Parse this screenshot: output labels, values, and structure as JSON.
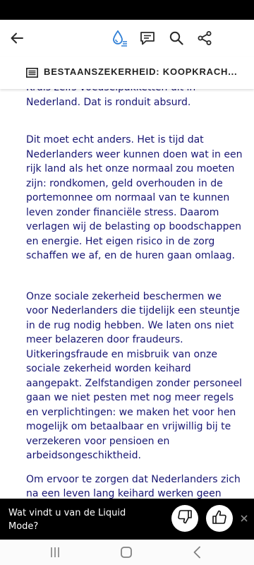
{
  "colors": {
    "text": "#181673",
    "toolbar_icon": "#2a2a2a",
    "liquid_mode_accent": "#2f7fd6",
    "banner_bg": "#000000",
    "nav_icon": "#808080"
  },
  "toolbar": {
    "back_icon": "arrow-left-icon",
    "liquid_mode_icon": "liquid-mode-icon",
    "comment_icon": "comment-icon",
    "search_icon": "search-icon",
    "share_icon": "share-icon"
  },
  "section": {
    "icon": "list-icon",
    "title": "BESTAANSZEKERHEID: KOOPKRACH..."
  },
  "article": {
    "paragraphs": [
      "Kruis zelfs voedselpakketten uit in Nederland. Dat is ronduit absurd.",
      "Dit moet echt anders. Het is tijd dat Nederlanders weer kunnen doen wat in een rijk land als het onze normaal zou moeten zijn: rondkomen, geld overhouden in de portemonnee om normaal van te kunnen leven zonder financiële stress. Daarom verlagen wij de belasting op boodschappen en energie. Het eigen risico in de zorg schaffen we af, en de huren gaan omlaag.",
      "Onze sociale zekerheid beschermen we voor Nederlanders die tijdelijk een steuntje in de rug nodig hebben. We laten ons niet meer belazeren door fraudeurs. Uitkeringsfraude en misbruik van onze sociale zekerheid worden keihard aangepakt. Zelfstandigen zonder personeel gaan we niet pesten met nog meer regels en verplichtingen: we maken het voor hen mogelijk om betaalbaar en vrijwillig bij te verzekeren voor pensioen en arbeidsongeschiktheid.",
      "Om ervoor te zorgen dat Nederlanders zich na een leven lang keihard werken geen zorgen meer hoeven te maken over hun oude dag, verhogen we de ouderenkorting en verlagen we de AOW-leeftijd. We draaien de"
    ]
  },
  "feedback": {
    "question": "Wat vindt u van de Liquid Mode?",
    "dislike_icon": "thumbs-down-icon",
    "like_icon": "thumbs-up-icon",
    "close_icon": "close-icon"
  },
  "navbar": {
    "recents_icon": "recents-icon",
    "home_icon": "home-icon",
    "back_icon": "back-icon"
  }
}
